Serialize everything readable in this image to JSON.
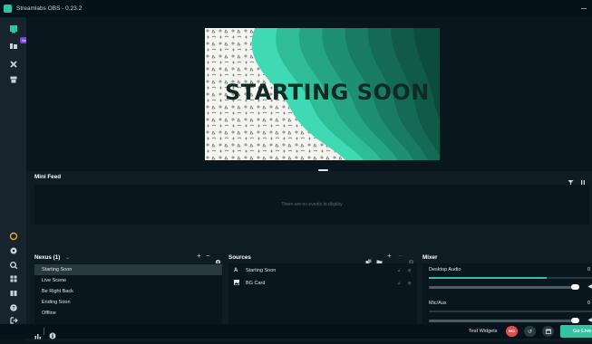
{
  "app": {
    "title": "Streamlabs OBS - 0.23.2"
  },
  "sidebar": {
    "new_badge": "New"
  },
  "preview": {
    "text": "STARTING SOON"
  },
  "mini_feed": {
    "title": "Mini Feed",
    "empty_message": "There are no events to display"
  },
  "scenes": {
    "title": "Nexus (1)",
    "items": [
      {
        "label": "Starting Soon",
        "active": true
      },
      {
        "label": "Live Scene",
        "active": false
      },
      {
        "label": "Be Right Back",
        "active": false
      },
      {
        "label": "Ending Soon",
        "active": false
      },
      {
        "label": "Offline",
        "active": false
      }
    ]
  },
  "sources": {
    "title": "Sources",
    "items": [
      {
        "label": "Starting Soon",
        "icon": "text-icon"
      },
      {
        "label": "BG Card",
        "icon": "image-icon"
      }
    ]
  },
  "mixer": {
    "title": "Mixer",
    "channels": [
      {
        "name": "Desktop Audio",
        "value": "0",
        "level": 0.72
      },
      {
        "name": "Mic/Aux",
        "value": "0",
        "level": 0.0
      }
    ]
  },
  "footer": {
    "test_widgets": "Test Widgets",
    "rec_label": "REC",
    "go_live": "Go Live"
  },
  "colors": {
    "accent": "#31c3a2",
    "rec": "#e14c4c",
    "badge": "#7c42d8"
  }
}
